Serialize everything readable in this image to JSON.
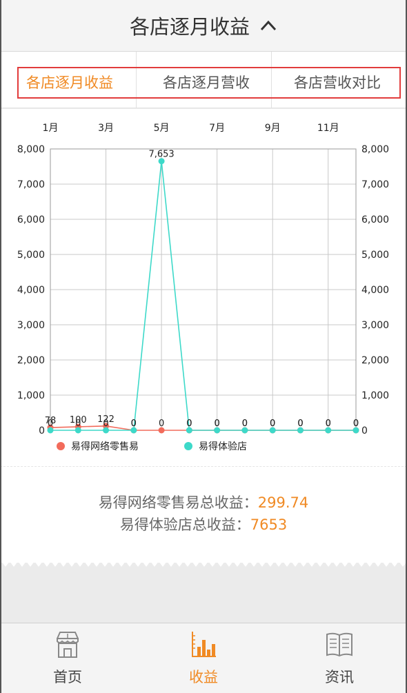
{
  "header": {
    "title": "各店逐月收益"
  },
  "tabs": [
    {
      "label": "各店逐月收益",
      "active": true
    },
    {
      "label": "各店逐月营收",
      "active": false
    },
    {
      "label": "各店营收对比",
      "active": false
    }
  ],
  "colors": {
    "accent": "#f08a24",
    "series1": "#f26b5b",
    "series2": "#3dd9c9",
    "highlight": "#e23b3b"
  },
  "chart_data": {
    "type": "line",
    "x": [
      1,
      2,
      3,
      4,
      5,
      6,
      7,
      8,
      9,
      10,
      11,
      12
    ],
    "x_tick_labels": [
      {
        "x": 1,
        "label": "1月"
      },
      {
        "x": 3,
        "label": "3月"
      },
      {
        "x": 5,
        "label": "5月"
      },
      {
        "x": 7,
        "label": "7月"
      },
      {
        "x": 9,
        "label": "9月"
      },
      {
        "x": 11,
        "label": "11月"
      }
    ],
    "xlim": [
      1,
      12
    ],
    "ylim": [
      0,
      8000
    ],
    "y_ticks": [
      0,
      1000,
      2000,
      3000,
      4000,
      5000,
      6000,
      7000,
      8000
    ],
    "y_tick_labels": [
      "0",
      "1,000",
      "2,000",
      "3,000",
      "4,000",
      "5,000",
      "6,000",
      "7,000",
      "8,000"
    ],
    "grid": true,
    "legend_position": "bottom-left",
    "series": [
      {
        "name": "易得网络零售易",
        "values": [
          78,
          100,
          122,
          0,
          0,
          0,
          0,
          0,
          0,
          0,
          0,
          0
        ],
        "labels": [
          "78",
          "100",
          "122",
          "0",
          "0",
          "0",
          "0",
          "0",
          "0",
          "0",
          "0",
          "0"
        ]
      },
      {
        "name": "易得体验店",
        "values": [
          0,
          0,
          0,
          0,
          7653,
          0,
          0,
          0,
          0,
          0,
          0,
          0
        ],
        "labels": [
          "0",
          "0",
          "0",
          "0",
          "7,653",
          "0",
          "0",
          "0",
          "0",
          "0",
          "0",
          "0"
        ]
      }
    ]
  },
  "summary": {
    "line1_label": "易得网络零售易总收益：",
    "line1_value": "299.74",
    "line2_label": "易得体验店总收益：",
    "line2_value": "7653"
  },
  "nav": [
    {
      "label": "首页",
      "icon": "store-icon",
      "active": false
    },
    {
      "label": "收益",
      "icon": "bar-chart-icon",
      "active": true
    },
    {
      "label": "资讯",
      "icon": "book-icon",
      "active": false
    }
  ]
}
